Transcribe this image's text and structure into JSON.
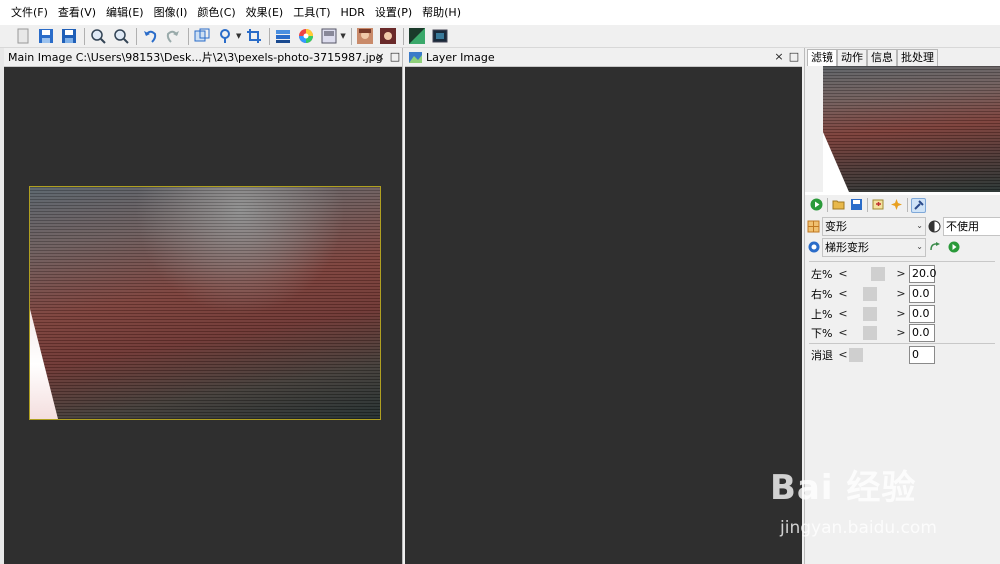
{
  "menu": {
    "items": [
      "文件(F)",
      "查看(V)",
      "编辑(E)",
      "图像(I)",
      "颜色(C)",
      "效果(E)",
      "工具(T)",
      "HDR",
      "设置(P)",
      "帮助(H)"
    ]
  },
  "toolbar": {
    "buttons": [
      "new-icon",
      "save-icon",
      "save-as-icon",
      "zoom-in-icon",
      "zoom-out-icon",
      "undo-icon",
      "redo-icon",
      "resize-icon",
      "rotate-icon",
      "crop-icon",
      "levels-icon",
      "color-wheel-icon",
      "layers-icon",
      "portrait-icon",
      "portrait-alt-icon",
      "filter-icon",
      "image-icon"
    ]
  },
  "main_panel": {
    "title": "Main Image C:\\Users\\98153\\Desk...片\\2\\3\\pexels-photo-3715987.jpg",
    "close": "×",
    "maximize": "□"
  },
  "layer_panel": {
    "title": "Layer Image",
    "close": "×",
    "maximize": "□"
  },
  "right_panel": {
    "tabs": [
      "滤镜",
      "动作",
      "信息",
      "批处理"
    ],
    "active_tab": 0,
    "category_combo": "变形",
    "blend_combo": "不使用",
    "effect_combo": "梯形变形",
    "params": [
      {
        "label": "左%",
        "value": "20.0",
        "level": 0.7
      },
      {
        "label": "右%",
        "value": "0.0",
        "level": 0.45
      },
      {
        "label": "上%",
        "value": "0.0",
        "level": 0.45
      },
      {
        "label": "下%",
        "value": "0.0",
        "level": 0.45
      },
      {
        "label": "消退",
        "value": "0",
        "level": 0.0
      }
    ]
  },
  "watermark": {
    "logo": "Bai 经验",
    "sub": "jingyan.baidu.com"
  }
}
